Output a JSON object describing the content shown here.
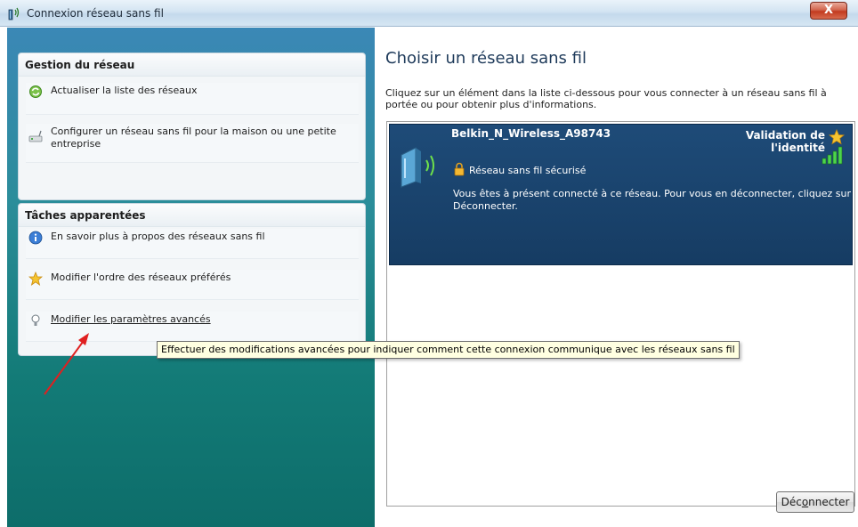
{
  "window": {
    "title": "Connexion réseau sans fil",
    "close_glyph": "X"
  },
  "left": {
    "network_panel": {
      "header": "Gestion du réseau",
      "items": [
        {
          "label": "Actualiser la liste des réseaux",
          "icon": "refresh-icon"
        },
        {
          "label": "Configurer un réseau sans fil pour la maison ou une petite entreprise",
          "icon": "router-icon"
        }
      ]
    },
    "related_panel": {
      "header": "Tâches apparentées",
      "items": [
        {
          "label": "En savoir plus à propos des réseaux sans fil",
          "icon": "info-icon"
        },
        {
          "label": "Modifier l'ordre des réseaux préférés",
          "icon": "star-icon"
        },
        {
          "label": "Modifier les paramètres avancés",
          "icon": "settings-bulb-icon"
        }
      ]
    }
  },
  "right": {
    "heading": "Choisir un réseau sans fil",
    "instruction": "Cliquez sur un élément dans la liste ci-dessous pour vous connecter à un réseau sans fil à portée ou pour obtenir plus d'informations.",
    "network": {
      "name": "Belkin_N_Wireless_A98743",
      "status_line1": "Validation de",
      "status_line2": "l'identité",
      "security": "Réseau sans fil sécurisé",
      "info": "Vous êtes à présent connecté à ce réseau. Pour vous en déconnecter, cliquez sur Déconnecter."
    },
    "disconnect_button": {
      "before": "Déc",
      "accel": "o",
      "after": "nnecter"
    }
  },
  "tooltip": "Effectuer des modifications avancées pour indiquer comment cette connexion communique avec les réseaux sans fil",
  "colors": {
    "selection": "#1e4b78",
    "pane_top": "#3b88b6",
    "pane_bottom": "#0d6d6a",
    "tooltip_bg": "#ffffe1",
    "arrow": "#e02020"
  }
}
